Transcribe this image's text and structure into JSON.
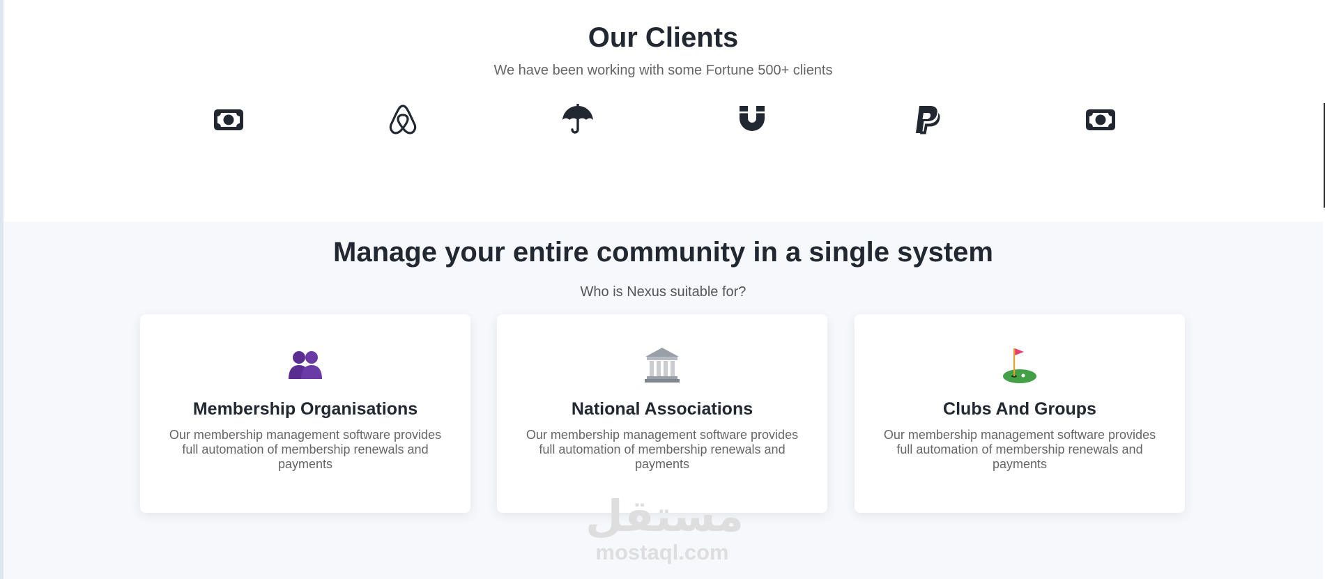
{
  "clients": {
    "title": "Our Clients",
    "subtitle": "We have been working with some Fortune 500+ clients",
    "logos": [
      "money-bill-icon",
      "airbnb-icon",
      "umbrella-icon",
      "magnet-icon",
      "paypal-icon",
      "money-bill-icon"
    ],
    "icon_color": "#222831"
  },
  "manage": {
    "title": "Manage your entire community in a single system",
    "subtitle": "Who is Nexus suitable for?",
    "cards": [
      {
        "icon": "two-people-icon",
        "title": "Membership Organisations",
        "text": "Our membership management software provides full automation of membership renewals and payments"
      },
      {
        "icon": "classical-building-icon",
        "title": "National Associations",
        "text": "Our membership management software provides full automation of membership renewals and payments"
      },
      {
        "icon": "golf-flag-icon",
        "title": "Clubs And Groups",
        "text": "Our membership management software provides full automation of membership renewals and payments"
      }
    ]
  },
  "watermark": {
    "arabic": "مستقل",
    "latin": "mostaql.com"
  },
  "colors": {
    "heading": "#222831",
    "muted_text": "#666666",
    "section_bg": "#f6f8fb",
    "card_bg": "#ffffff"
  }
}
